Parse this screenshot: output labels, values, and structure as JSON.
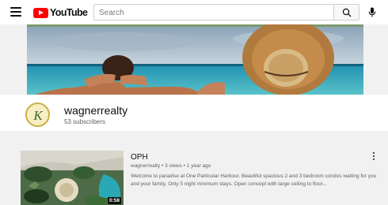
{
  "header": {
    "logo_text": "YouTube",
    "search_placeholder": "Search"
  },
  "channel": {
    "name": "wagnerrealty",
    "subscribers": "53 subscribers",
    "avatar_letters": "K"
  },
  "video": {
    "title": "OPH",
    "meta": "wagnerrealty • 3 views • 1 year ago",
    "description": "Welcome to paradise at One Particular Harbour. Beautiful spacious 2 and 3 bedroom condos waiting for you and your family. Only 5 night minimum stays. Open concept with large ceiling to floor...",
    "duration": "0:58"
  },
  "colors": {
    "brand": "#ff0000",
    "page_background": "#f1f1f1",
    "header_background": "#ffffff"
  },
  "icons": [
    "menu-icon",
    "youtube-logo-icon",
    "search-icon",
    "microphone-icon",
    "more-vert-icon"
  ]
}
